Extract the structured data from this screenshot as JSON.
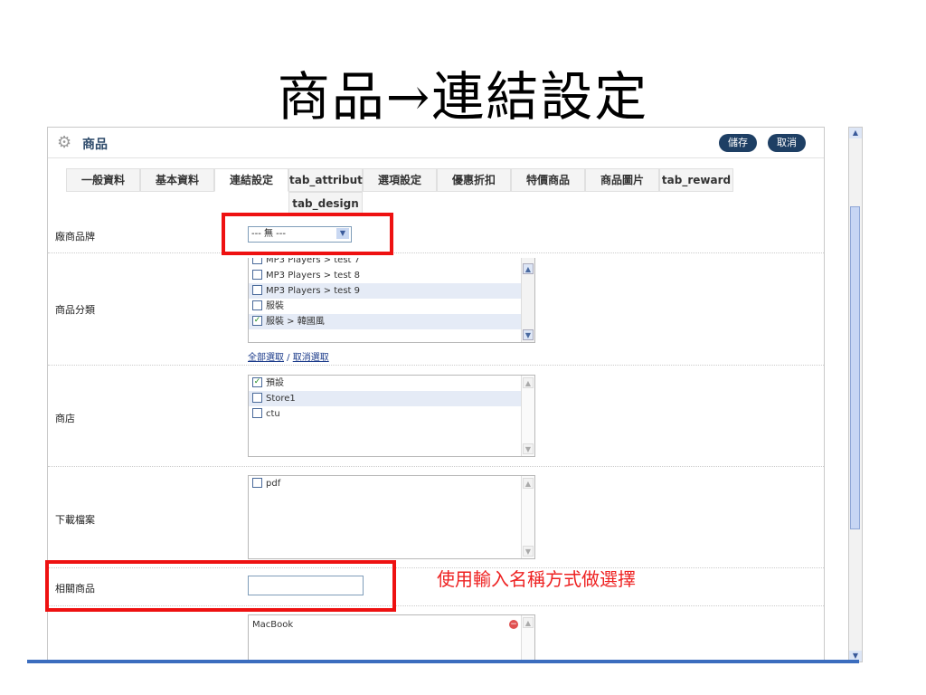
{
  "slide": {
    "title": "商品→連結設定"
  },
  "panel": {
    "title": "商品",
    "save_label": "儲存",
    "cancel_label": "取消",
    "tabs": [
      {
        "label": "一般資料"
      },
      {
        "label": "基本資料"
      },
      {
        "label": "連結設定",
        "active": true
      },
      {
        "label": "tab_attribute"
      },
      {
        "label": "選項設定"
      },
      {
        "label": "優惠折扣"
      },
      {
        "label": "特價商品"
      },
      {
        "label": "商品圖片"
      },
      {
        "label": "tab_reward"
      },
      {
        "label": "tab_design"
      }
    ],
    "manufacturer": {
      "label": "廠商品牌",
      "value": "--- 無 ---"
    },
    "category": {
      "label": "商品分類",
      "items": [
        {
          "label": "MP3 Players > test 7",
          "checked": false
        },
        {
          "label": "MP3 Players > test 8",
          "checked": false
        },
        {
          "label": "MP3 Players > test 9",
          "checked": false
        },
        {
          "label": "服裝",
          "checked": false
        },
        {
          "label": "服裝 > 韓國風",
          "checked": true
        }
      ],
      "select_all": "全部選取",
      "separator": " / ",
      "unselect_all": "取消選取"
    },
    "store": {
      "label": "商店",
      "items": [
        {
          "label": "預設",
          "checked": true
        },
        {
          "label": "Store1",
          "checked": false
        },
        {
          "label": "ctu",
          "checked": false
        }
      ]
    },
    "download": {
      "label": "下載檔案",
      "items": [
        {
          "label": "pdf",
          "checked": false
        }
      ]
    },
    "related": {
      "label": "相關商品",
      "input_value": "",
      "selected": [
        "MacBook"
      ]
    }
  },
  "annotation": {
    "note": "使用輸入名稱方式做選擇",
    "color": "#ee2222"
  },
  "colors": {
    "header_button": "#1e3f64",
    "highlight_row": "#e5ebf6",
    "scroll_thumb": "#c7d6f4"
  }
}
